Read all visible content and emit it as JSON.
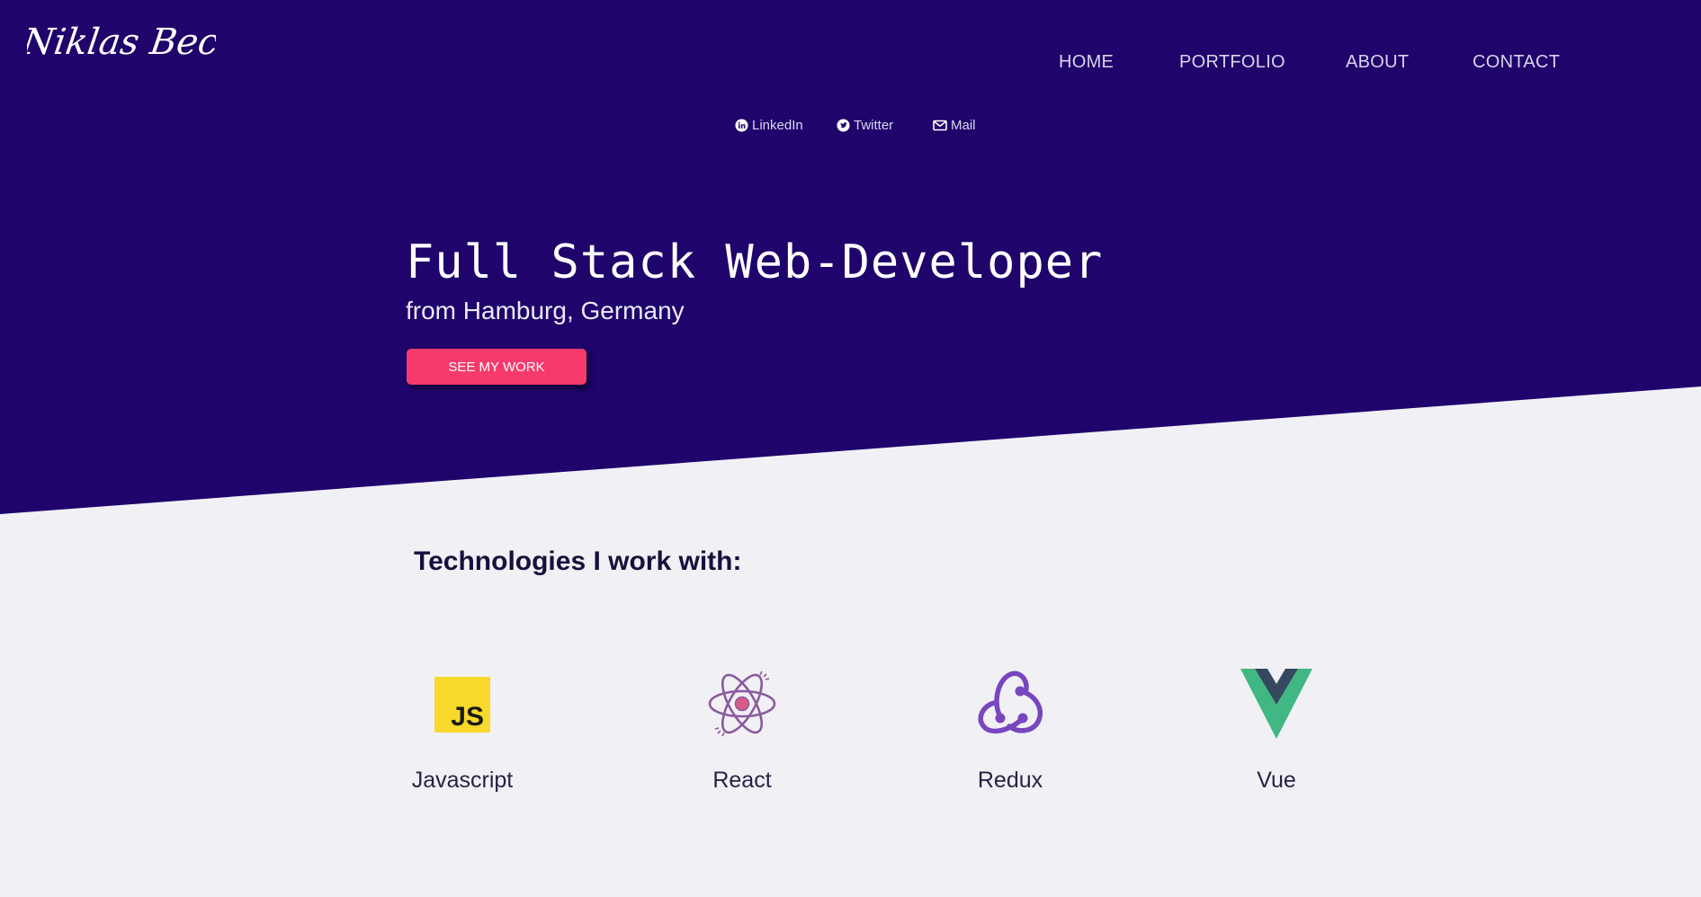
{
  "brand": {
    "logo_text": "Niklas Becker",
    "hero_color": "#1e046b",
    "accent_color": "#f73a6c",
    "background_color": "#f1f0f5"
  },
  "nav": {
    "items": [
      {
        "label": "HOME"
      },
      {
        "label": "PORTFOLIO"
      },
      {
        "label": "ABOUT"
      },
      {
        "label": "CONTACT"
      }
    ]
  },
  "social": {
    "linkedin": {
      "label": "LinkedIn",
      "icon": "linkedin-icon"
    },
    "twitter": {
      "label": "Twitter",
      "icon": "twitter-icon"
    },
    "mail": {
      "label": "Mail",
      "icon": "mail-icon"
    }
  },
  "hero": {
    "headline": "Full Stack Web-Developer",
    "subline": "from Hamburg, Germany",
    "cta_label": "SEE MY WORK"
  },
  "technologies": {
    "heading": "Technologies I work with:",
    "items": [
      {
        "label": "Javascript",
        "icon": "javascript-icon"
      },
      {
        "label": "React",
        "icon": "react-icon"
      },
      {
        "label": "Redux",
        "icon": "redux-icon"
      },
      {
        "label": "Vue",
        "icon": "vue-icon"
      }
    ]
  }
}
